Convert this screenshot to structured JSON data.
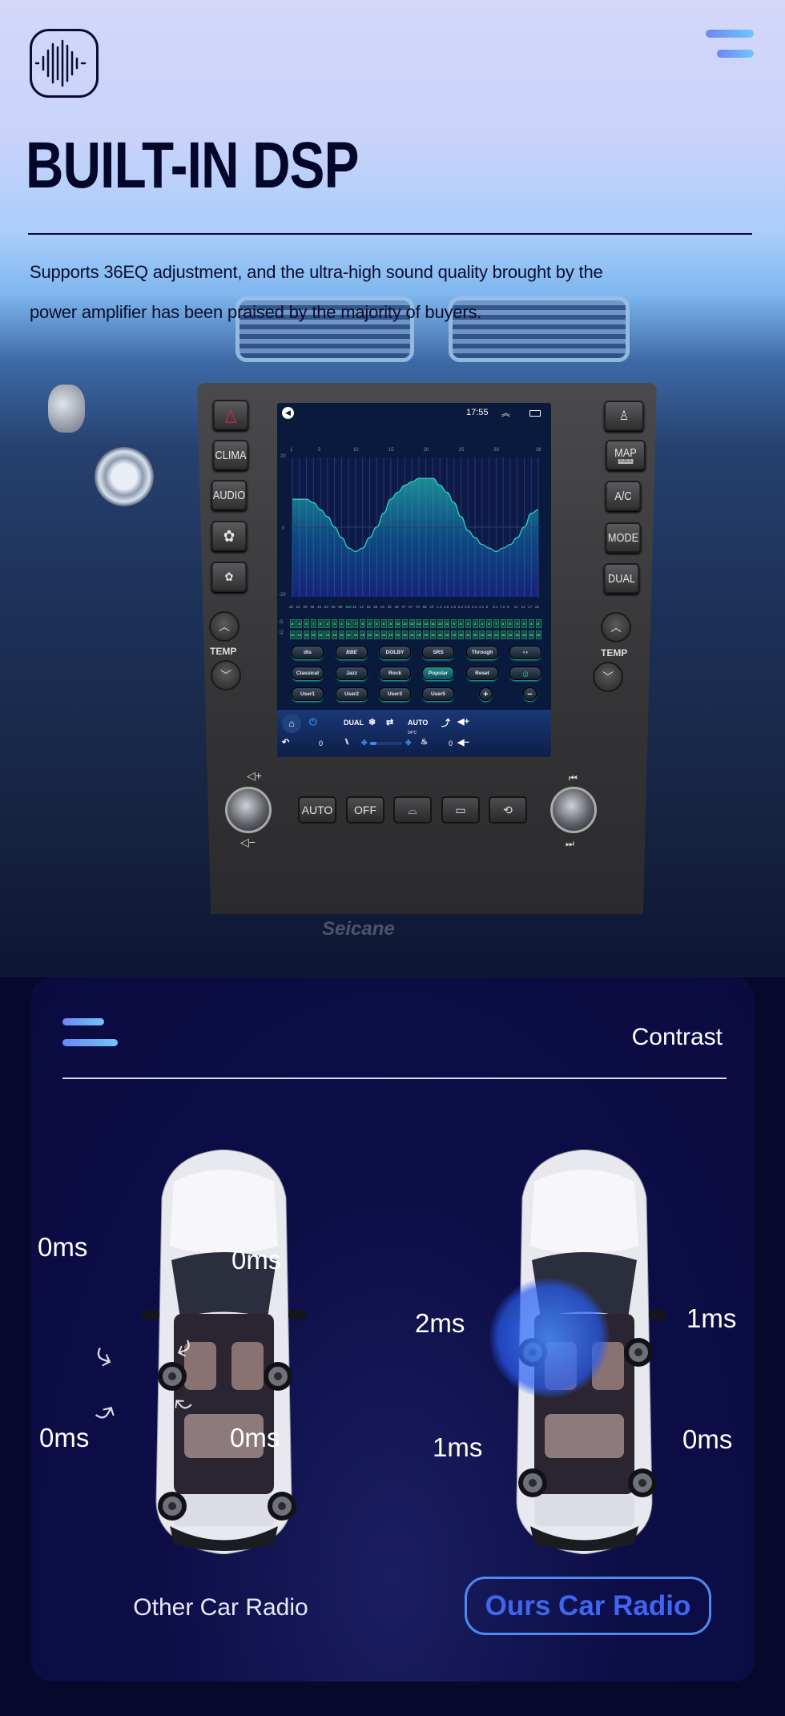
{
  "header": {
    "logo_icon": "sound-wave-icon",
    "menu_icon": "menu-icon",
    "title": "BUILT-IN DSP",
    "description_line1": "Supports 36EQ adjustment, and the ultra-high sound quality brought by the",
    "description_line2": "power amplifier has been praised by the majority of buyers."
  },
  "dashboard": {
    "left_buttons": [
      "hazard-icon",
      "CLIMA",
      "AUDIO",
      "fan-high-icon",
      "fan-low-icon"
    ],
    "right_buttons": [
      "passenger-seatbelt-icon",
      "MAP",
      "A/C",
      "MODE",
      "DUAL"
    ],
    "map_sublabel": "VOICE",
    "temp_label": "TEMP",
    "bottom_buttons": [
      "AUTO",
      "OFF",
      "front-defrost-icon",
      "rear-defrost-icon",
      "recirculation-icon"
    ],
    "watermark": "Seicane",
    "screen": {
      "time": "17:55",
      "band_labels": [
        "1",
        "5",
        "10",
        "15",
        "20",
        "25",
        "30",
        "36"
      ],
      "y_labels": [
        "20",
        "0",
        "-20"
      ],
      "eq_gain_curve": [
        8,
        8,
        8,
        7,
        5,
        3,
        0,
        -3,
        -6,
        -7,
        -6,
        -3,
        0,
        4,
        8,
        10,
        12,
        13,
        14,
        14,
        14,
        12,
        10,
        7,
        3,
        -1,
        -3,
        -5,
        -6,
        -7,
        -6,
        -5,
        -3,
        0,
        4,
        5
      ],
      "frequencies": [
        "20",
        "24",
        "29",
        "36",
        "45",
        "53",
        "65",
        "80",
        "100",
        "12",
        "14",
        "18",
        "28",
        "26",
        "32",
        "39",
        "47",
        "57",
        "70",
        "85",
        "1k",
        "1.3",
        "1.6",
        "1.9",
        "2.3",
        "2.8",
        "3.4",
        "4.1",
        "5",
        "6.1",
        "7.5",
        "9",
        "11",
        "14",
        "17",
        "20"
      ],
      "g_label": "G",
      "q_label": "Q",
      "g_values": [
        "8",
        "8",
        "8",
        "7",
        "8",
        "3",
        "0",
        "4",
        "6",
        "7",
        "6",
        "3",
        "0",
        "8",
        "8",
        "10",
        "12",
        "13",
        "14",
        "14",
        "14",
        "13",
        "11",
        "9",
        "6",
        "2",
        "2",
        "4",
        "6",
        "7",
        "6",
        "8",
        "3",
        "0",
        "4",
        "8"
      ],
      "q_value": "16",
      "effect_buttons": [
        "dts",
        "BBE",
        "DOLBY",
        "SRS",
        "Through",
        "surround-icon"
      ],
      "preset_buttons": [
        "Classical",
        "Jazz",
        "Rock",
        "Popular",
        "Reset",
        "info-icon"
      ],
      "user_buttons": [
        "User1",
        "User2",
        "User3",
        "User5",
        "+",
        "−"
      ],
      "active_preset": "Popular",
      "climate": {
        "dual": "DUAL",
        "auto": "AUTO",
        "temp": "24°C",
        "left_value": "0",
        "right_value": "0",
        "fan_level": 0.2
      }
    }
  },
  "contrast": {
    "menu_icon": "menu-icon",
    "title": "Contrast",
    "other": {
      "label": "Other Car Radio",
      "front_left": "0ms",
      "front_right": "0ms",
      "rear_left": "0ms",
      "rear_right": "0ms"
    },
    "ours": {
      "label": "Ours Car Radio",
      "front_left": "2ms",
      "front_right": "1ms",
      "rear_left": "1ms",
      "rear_right": "0ms"
    }
  },
  "colors": {
    "accent_gradient_start": "#6d86f7",
    "accent_gradient_end": "#6fc6f7",
    "eq_line": "#2fd1c3",
    "ours_button": "#3f66f0",
    "panel_bg": "#0d0e48"
  }
}
